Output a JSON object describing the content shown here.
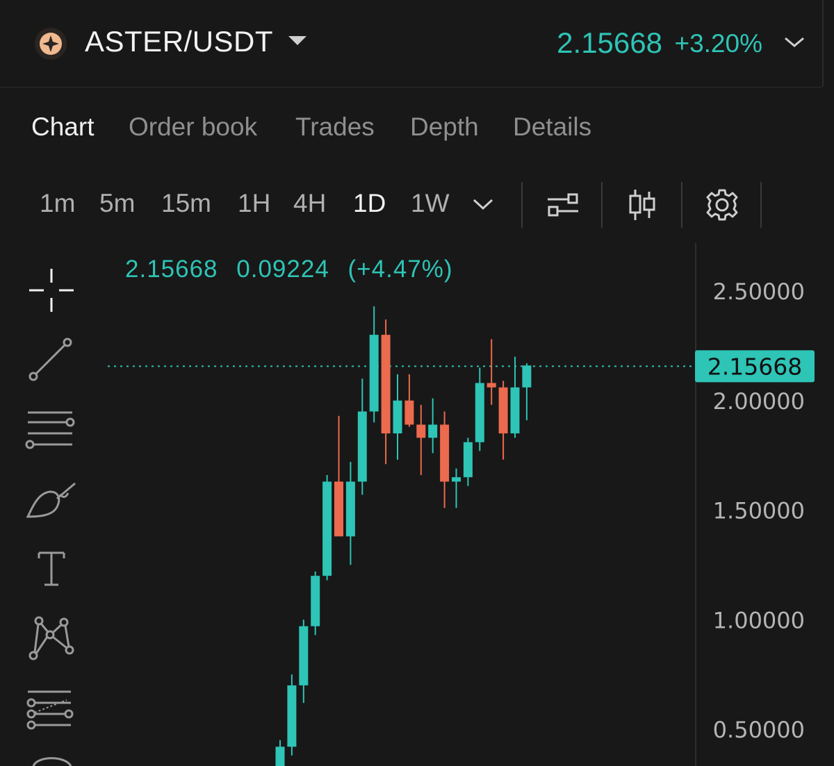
{
  "header": {
    "pair": "ASTER/USDT",
    "price": "2.15668",
    "change": "+3.20%"
  },
  "tabs": [
    "Chart",
    "Order book",
    "Trades",
    "Depth",
    "Details"
  ],
  "active_tab": "Chart",
  "intervals": [
    "1m",
    "5m",
    "15m",
    "1H",
    "4H",
    "1D",
    "1W"
  ],
  "active_interval": "1D",
  "toolbar_icons": [
    "indicator-settings-icon",
    "candle-type-icon",
    "gear-icon"
  ],
  "drawing_tools": [
    "crosshair-icon",
    "trend-line-icon",
    "parallel-lines-icon",
    "brush-icon",
    "text-icon",
    "pattern-icon",
    "fib-icon",
    "measure-icon"
  ],
  "ohlc": {
    "close": "2.15668",
    "change": "0.09224",
    "change_pct": "(+4.47%)"
  },
  "colors": {
    "up": "#2ec4b6",
    "down": "#ec6a4e",
    "background": "#181818"
  },
  "chart_data": {
    "type": "candlestick",
    "y_axis": [
      "2.50000",
      "2.00000",
      "1.50000",
      "1.00000",
      "0.50000"
    ],
    "ylim": [
      0.35,
      2.65
    ],
    "last_price_label": "2.15668",
    "last_price": 2.15668,
    "candles": [
      {
        "o": 0.3,
        "h": 0.45,
        "l": 0.25,
        "c": 0.42
      },
      {
        "o": 0.42,
        "h": 0.75,
        "l": 0.38,
        "c": 0.7
      },
      {
        "o": 0.7,
        "h": 1.0,
        "l": 0.62,
        "c": 0.97
      },
      {
        "o": 0.97,
        "h": 1.22,
        "l": 0.93,
        "c": 1.2
      },
      {
        "o": 1.2,
        "h": 1.66,
        "l": 1.18,
        "c": 1.63
      },
      {
        "o": 1.63,
        "h": 1.93,
        "l": 1.55,
        "c": 1.38
      },
      {
        "o": 1.38,
        "h": 1.72,
        "l": 1.25,
        "c": 1.63
      },
      {
        "o": 1.63,
        "h": 2.1,
        "l": 1.57,
        "c": 1.95
      },
      {
        "o": 1.95,
        "h": 2.43,
        "l": 1.9,
        "c": 2.3
      },
      {
        "o": 2.3,
        "h": 2.37,
        "l": 1.71,
        "c": 1.85
      },
      {
        "o": 1.85,
        "h": 2.12,
        "l": 1.73,
        "c": 2.0
      },
      {
        "o": 2.0,
        "h": 2.12,
        "l": 1.88,
        "c": 1.89
      },
      {
        "o": 1.89,
        "h": 1.98,
        "l": 1.66,
        "c": 1.83
      },
      {
        "o": 1.83,
        "h": 2.01,
        "l": 1.76,
        "c": 1.89
      },
      {
        "o": 1.89,
        "h": 1.95,
        "l": 1.51,
        "c": 1.63
      },
      {
        "o": 1.63,
        "h": 1.69,
        "l": 1.51,
        "c": 1.65
      },
      {
        "o": 1.65,
        "h": 1.83,
        "l": 1.61,
        "c": 1.81
      },
      {
        "o": 1.81,
        "h": 2.15,
        "l": 1.77,
        "c": 2.08
      },
      {
        "o": 2.08,
        "h": 2.28,
        "l": 1.98,
        "c": 2.06
      },
      {
        "o": 2.06,
        "h": 2.09,
        "l": 1.73,
        "c": 1.85
      },
      {
        "o": 1.85,
        "h": 2.2,
        "l": 1.83,
        "c": 2.06
      },
      {
        "o": 2.06,
        "h": 2.17,
        "l": 1.91,
        "c": 2.16
      }
    ]
  }
}
